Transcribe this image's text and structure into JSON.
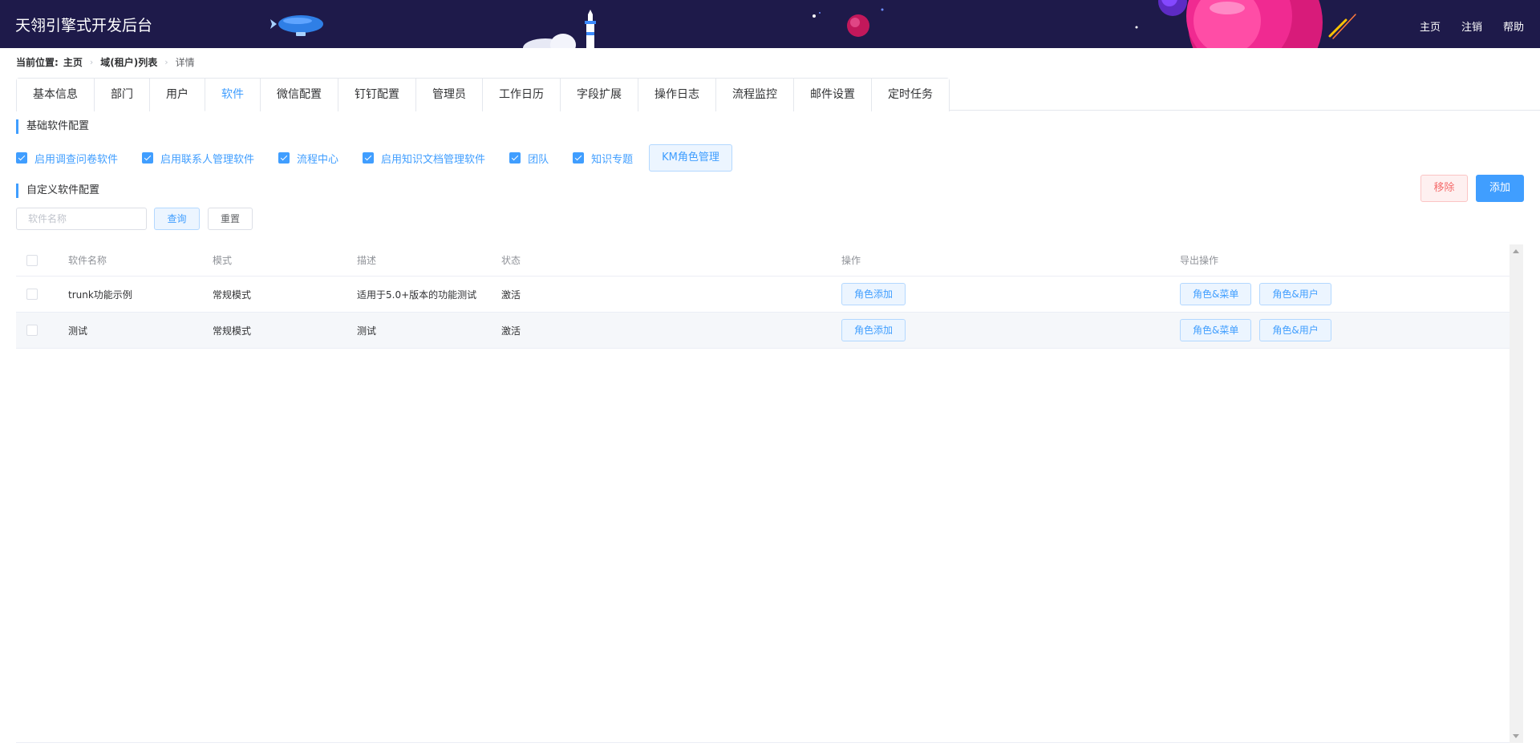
{
  "header": {
    "title": "天翎引擎式开发后台",
    "links": [
      "主页",
      "注销",
      "帮助"
    ]
  },
  "breadcrumb": {
    "prefix": "当前位置:",
    "items": [
      "主页",
      "域(租户)列表",
      "详情"
    ]
  },
  "tabs": [
    {
      "label": "基本信息",
      "active": false
    },
    {
      "label": "部门",
      "active": false
    },
    {
      "label": "用户",
      "active": false
    },
    {
      "label": "软件",
      "active": true
    },
    {
      "label": "微信配置",
      "active": false
    },
    {
      "label": "钉钉配置",
      "active": false
    },
    {
      "label": "管理员",
      "active": false
    },
    {
      "label": "工作日历",
      "active": false
    },
    {
      "label": "字段扩展",
      "active": false
    },
    {
      "label": "操作日志",
      "active": false
    },
    {
      "label": "流程监控",
      "active": false
    },
    {
      "label": "邮件设置",
      "active": false
    },
    {
      "label": "定时任务",
      "active": false
    }
  ],
  "basic_config": {
    "title": "基础软件配置",
    "options": [
      {
        "label": "启用调查问卷软件",
        "checked": true
      },
      {
        "label": "启用联系人管理软件",
        "checked": true
      },
      {
        "label": "流程中心",
        "checked": true
      },
      {
        "label": "启用知识文档管理软件",
        "checked": true
      },
      {
        "label": "团队",
        "checked": true
      },
      {
        "label": "知识专题",
        "checked": true
      }
    ],
    "km_button": "KM角色管理"
  },
  "custom_config": {
    "title": "自定义软件配置",
    "remove_button": "移除",
    "add_button": "添加",
    "search_placeholder": "软件名称",
    "query_button": "查询",
    "reset_button": "重置"
  },
  "table": {
    "columns": [
      "软件名称",
      "模式",
      "描述",
      "状态",
      "操作",
      "导出操作"
    ],
    "rows": [
      {
        "name": "trunk功能示例",
        "mode": "常规模式",
        "desc": "适用于5.0+版本的功能测试",
        "status": "激活",
        "action": "角色添加",
        "export": [
          "角色&菜单",
          "角色&用户"
        ]
      },
      {
        "name": "测试",
        "mode": "常规模式",
        "desc": "测试",
        "status": "激活",
        "action": "角色添加",
        "export": [
          "角色&菜单",
          "角色&用户"
        ]
      }
    ]
  },
  "colors": {
    "header_bg": "#1e1a4a",
    "accent": "#409eff",
    "danger": "#f56c6c"
  }
}
